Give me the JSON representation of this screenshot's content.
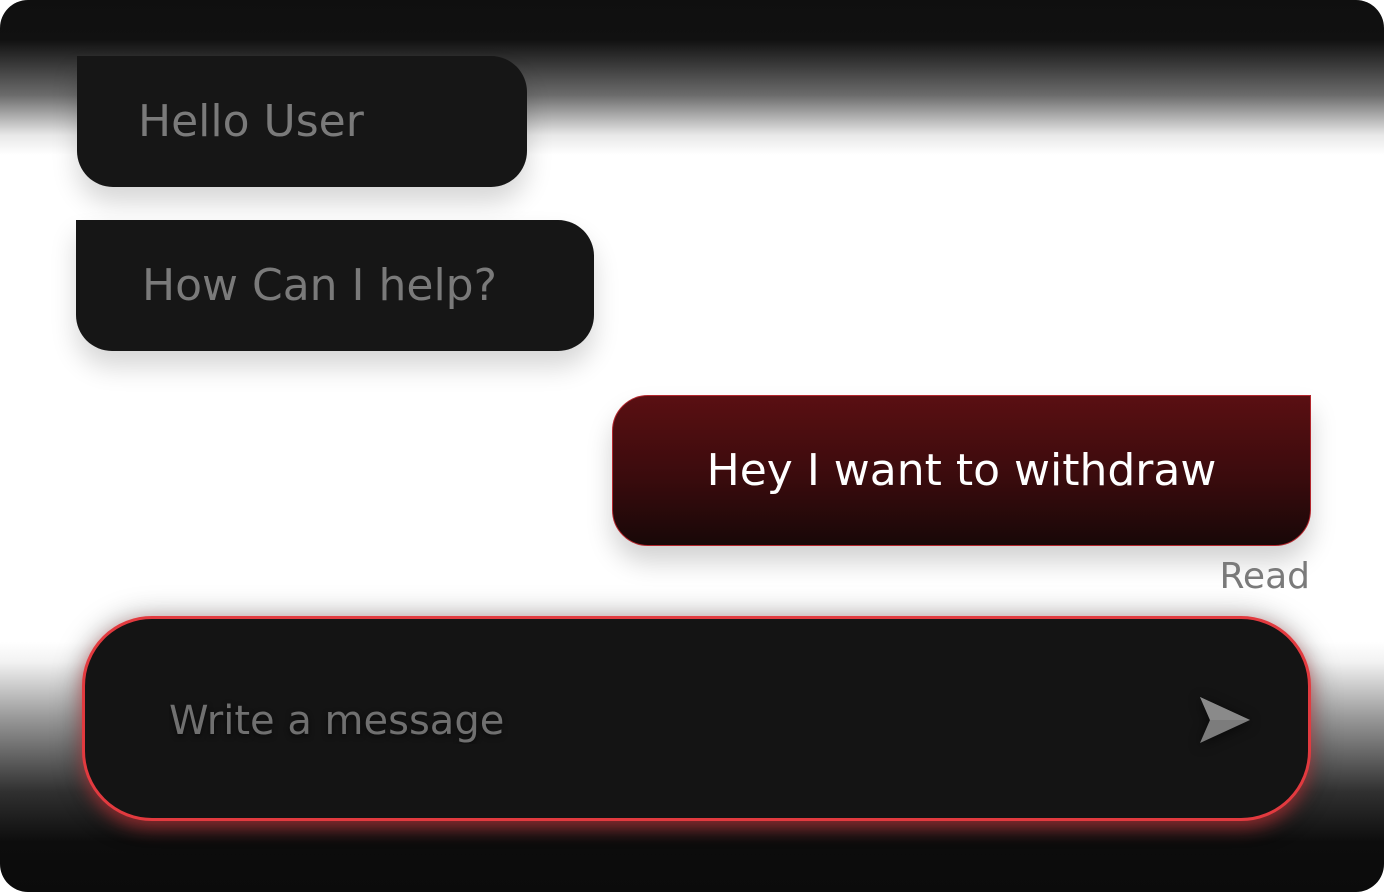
{
  "messages": [
    {
      "direction": "incoming",
      "text": "Hello User"
    },
    {
      "direction": "incoming",
      "text": "How Can I help?"
    },
    {
      "direction": "outgoing",
      "text": "Hey I want to withdraw",
      "status": "Read"
    }
  ],
  "composer": {
    "placeholder": "Write a message",
    "send_icon": "send-icon"
  },
  "colors": {
    "incoming_bubble": "#161616",
    "incoming_text": "#7a7a7a",
    "outgoing_bubble_top": "#5a0f12",
    "outgoing_bubble_bottom": "#180808",
    "outgoing_text": "#ffffff",
    "composer_border": "#e23a3f",
    "composer_background": "#141414"
  }
}
